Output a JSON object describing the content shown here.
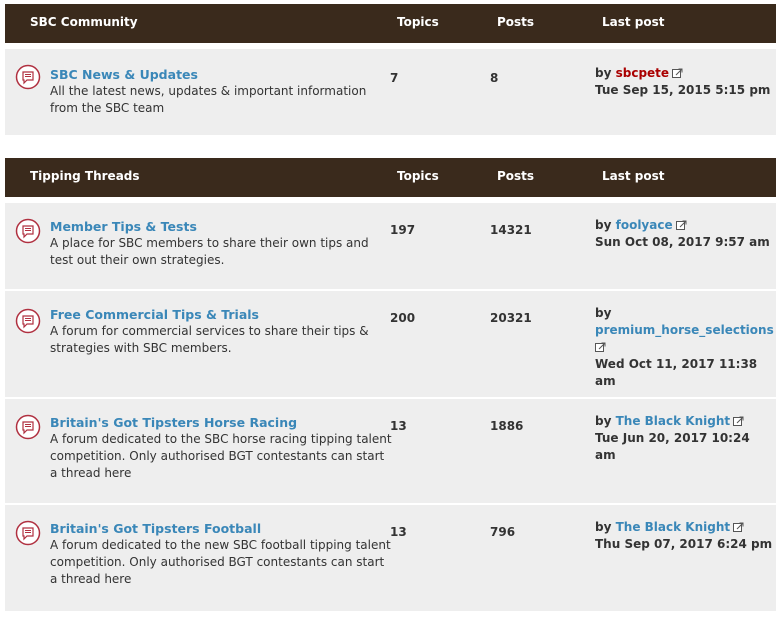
{
  "sections": [
    {
      "title": "SBC Community",
      "col_topics": "Topics",
      "col_posts": "Posts",
      "col_last": "Last post",
      "forums": [
        {
          "name": "SBC News & Updates",
          "desc": "All the latest news, updates & important information from the SBC team",
          "topics": "7",
          "posts": "8",
          "by": "by",
          "author": "sbcpete",
          "date": "Tue Sep 15, 2015 5:15 pm"
        }
      ]
    },
    {
      "title": "Tipping Threads",
      "col_topics": "Topics",
      "col_posts": "Posts",
      "col_last": "Last post",
      "forums": [
        {
          "name": "Member Tips & Tests",
          "desc": "A place for SBC members to share their own tips and test out their own strategies.",
          "topics": "197",
          "posts": "14321",
          "by": "by",
          "author": "foolyace",
          "date": "Sun Oct 08, 2017 9:57 am"
        },
        {
          "name": "Free Commercial Tips & Trials",
          "desc": "A forum for commercial services to share their tips & strategies with SBC members.",
          "topics": "200",
          "posts": "20321",
          "by": "by",
          "author": "premium_horse_selections",
          "date": "Wed Oct 11, 2017 11:38 am"
        },
        {
          "name": "Britain's Got Tipsters Horse Racing",
          "desc": "A forum dedicated to the SBC horse racing tipping talent competition. Only authorised BGT contestants can start a thread here",
          "topics": "13",
          "posts": "1886",
          "by": "by",
          "author": "The Black Knight",
          "date": "Tue Jun 20, 2017 10:24 am"
        },
        {
          "name": "Britain's Got Tipsters Football",
          "desc": "A forum dedicated to the new SBC football tipping talent competition. Only authorised BGT contestants can start a thread here",
          "topics": "13",
          "posts": "796",
          "by": "by",
          "author": "The Black Knight",
          "date": "Thu Sep 07, 2017 6:24 pm"
        }
      ]
    }
  ],
  "icons": {
    "forum": "forum-read-icon",
    "goto": "view-latest-post-icon"
  },
  "colors": {
    "header_bg": "#3a2a1c",
    "row_bg": "#eeeeee",
    "link": "#3a87b8",
    "author_red": "#aa0000",
    "icon_red": "#b03040"
  }
}
